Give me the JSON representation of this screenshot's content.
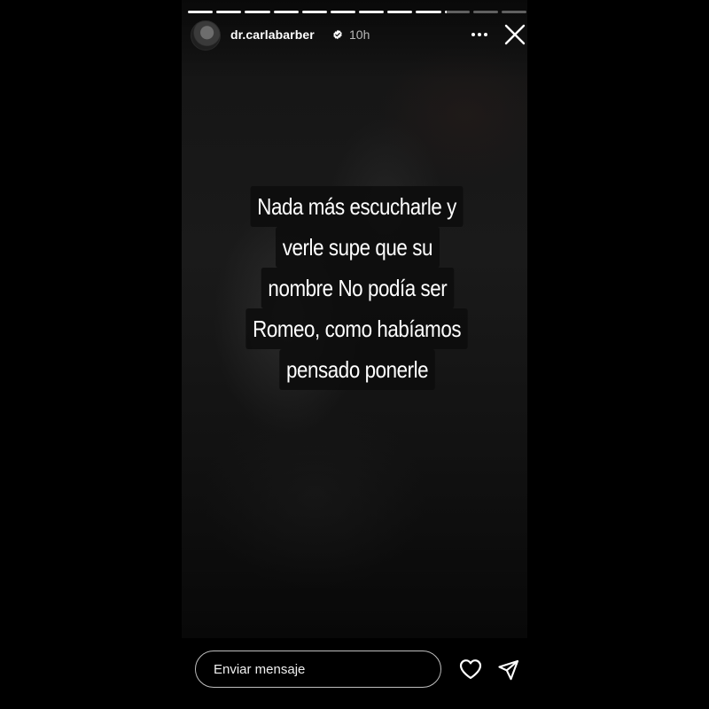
{
  "story": {
    "username": "dr.carlabarber",
    "verified": true,
    "time_ago": "10h",
    "segment_count": 12,
    "completed_segments": 9,
    "current_segment_progress": 0.1,
    "caption_lines": [
      "Nada más escucharle y",
      "verle supe que su",
      "nombre No podía ser",
      "Romeo, como habíamos",
      "pensado ponerle"
    ]
  },
  "reply": {
    "placeholder": "Enviar mensaje"
  },
  "icons": {
    "avatar": "profile-avatar",
    "verified": "verified-badge-icon",
    "more": "more-options-icon",
    "close": "close-icon",
    "like": "heart-icon",
    "share": "send-icon"
  },
  "colors": {
    "background": "#000000",
    "text": "#ffffff",
    "caption_bg": "#0c0c0c",
    "progress_active": "#f2f2f2",
    "verified_badge": "#ffffff"
  }
}
